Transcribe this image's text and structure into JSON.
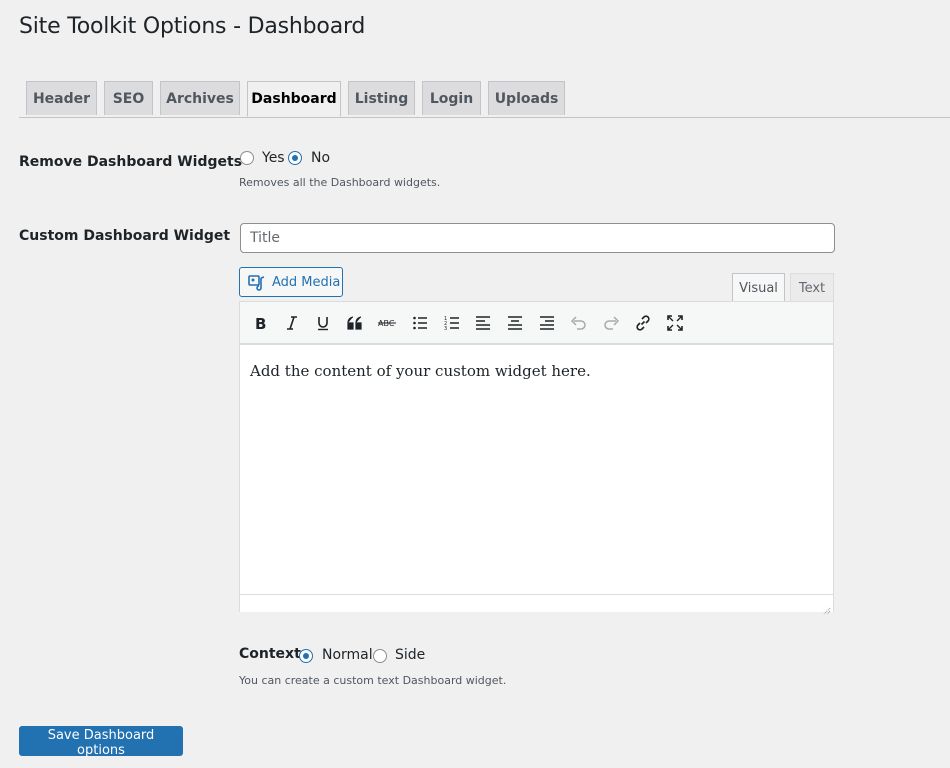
{
  "page": {
    "title": "Site Toolkit Options - Dashboard"
  },
  "tabs": [
    {
      "label": "Header",
      "active": false
    },
    {
      "label": "SEO",
      "active": false
    },
    {
      "label": "Archives",
      "active": false
    },
    {
      "label": "Dashboard",
      "active": true
    },
    {
      "label": "Listing",
      "active": false
    },
    {
      "label": "Login",
      "active": false
    },
    {
      "label": "Uploads",
      "active": false
    }
  ],
  "remove_widgets": {
    "label": "Remove Dashboard Widgets",
    "options": [
      "Yes",
      "No"
    ],
    "selected": "No",
    "description": "Removes all the Dashboard widgets."
  },
  "custom_widget": {
    "label": "Custom Dashboard Widget",
    "title_placeholder": "Title",
    "title_value": "",
    "add_media_label": "Add Media",
    "editor_tabs": [
      "Visual",
      "Text"
    ],
    "active_editor_tab": "Visual",
    "toolbar_icons": [
      "bold-icon",
      "italic-icon",
      "underline-icon",
      "blockquote-icon",
      "strikethrough-icon",
      "bullet-list-icon",
      "numbered-list-icon",
      "align-left-icon",
      "align-center-icon",
      "align-right-icon",
      "undo-icon",
      "redo-icon",
      "link-icon",
      "fullscreen-icon"
    ],
    "content": "Add the content of your custom widget here."
  },
  "context": {
    "label": "Context",
    "options": [
      "Normal",
      "Side"
    ],
    "selected": "Normal",
    "description": "You can create a custom text Dashboard widget."
  },
  "save_button": {
    "label": "Save Dashboard options"
  },
  "colors": {
    "accent": "#2271b1",
    "background": "#f0f0f1",
    "tab_inactive": "#dcdcde"
  }
}
